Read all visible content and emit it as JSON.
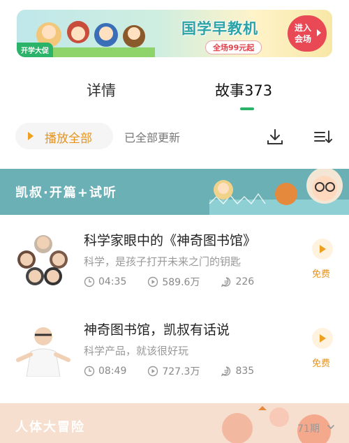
{
  "banner": {
    "promo_tag": "开学大促",
    "title": "国学早教机",
    "subtitle": "全场99元起",
    "enter_label_line1": "进入",
    "enter_label_line2": "会场"
  },
  "tabs": [
    {
      "label": "详情"
    },
    {
      "label": "故事373"
    }
  ],
  "actions": {
    "play_all_label": "播放全部",
    "updated_text": "已全部更新"
  },
  "section1": {
    "title": "凯叔·开篇+试听"
  },
  "items": [
    {
      "title": "科学家眼中的《神奇图书馆》",
      "desc": "科学，是孩子打开未来之门的钥匙",
      "duration": "04:35",
      "plays": "589.6万",
      "comments": "226",
      "badge": "免费"
    },
    {
      "title": "神奇图书馆，凯叔有话说",
      "desc": "科学产品，就该很好玩",
      "duration": "08:49",
      "plays": "727.3万",
      "comments": "835",
      "badge": "免费"
    }
  ],
  "section2": {
    "title": "人体大冒险",
    "periods": "71期"
  },
  "colors": {
    "accent_green": "#2bb36a",
    "accent_orange": "#e8931b",
    "section1_bg": "#6bb0b5",
    "section2_bg": "#f6dfcf"
  }
}
